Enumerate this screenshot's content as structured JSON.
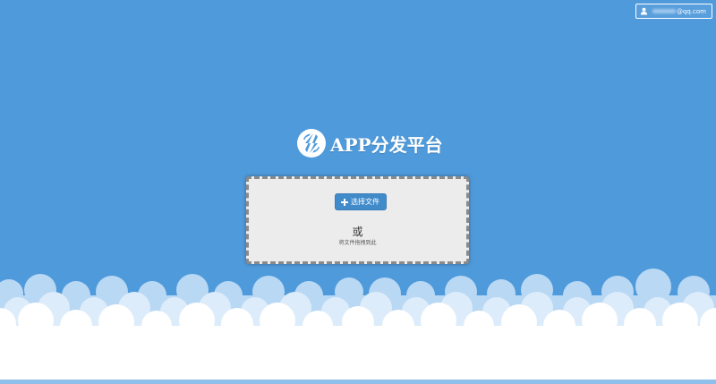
{
  "header": {
    "user_email_suffix": "@qq.com",
    "user_icon": "user-icon"
  },
  "brand": {
    "logo_icon": "app-logo-icon",
    "title": "APP分发平台"
  },
  "upload": {
    "select_button_label": "选择文件",
    "select_button_icon": "plus-icon",
    "or_text": "或",
    "drag_hint": "将文件拖拽到此"
  },
  "colors": {
    "sky": "#4f9adb",
    "button": "#428bca",
    "drop_zone_bg": "#ececec",
    "cloud": "#ffffff"
  }
}
